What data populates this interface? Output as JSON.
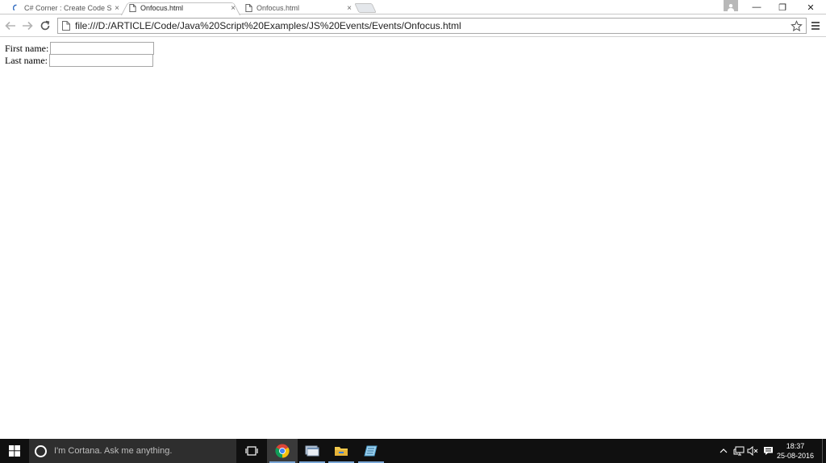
{
  "browser": {
    "tabs": [
      {
        "title": "C# Corner : Create Code S",
        "close": "×",
        "active": false
      },
      {
        "title": "Onfocus.html",
        "close": "×",
        "active": true
      },
      {
        "title": "Onfocus.html",
        "close": "×",
        "active": false
      }
    ],
    "window_controls": {
      "minimize": "—",
      "restore": "❐",
      "close": "✕"
    },
    "address": {
      "url": "file:///D:/ARTICLE/Code/Java%20Script%20Examples/JS%20Events/Events/Onfocus.html"
    },
    "icons": {
      "back": "back-arrow-icon",
      "forward": "forward-arrow-icon",
      "reload": "reload-icon",
      "page": "page-icon",
      "bookmark": "star-icon",
      "menu": "hamburger-menu-icon",
      "user": "user-icon"
    }
  },
  "page": {
    "first_name_label": "First name:",
    "first_name_value": "",
    "last_name_label": "Last name:",
    "last_name_value": ""
  },
  "taskbar": {
    "search_placeholder": "I'm Cortana. Ask me anything.",
    "apps": [
      "task-view-icon",
      "chrome-icon",
      "explorer-window-icon",
      "file-explorer-icon",
      "notepad-icon"
    ],
    "tray_icons": [
      "chevron-up-icon",
      "network-icon",
      "volume-muted-icon",
      "notification-icon"
    ],
    "time": "18:37",
    "date": "25-08-2016"
  },
  "colors": {
    "taskbar_bg": "#101010",
    "cortana_bg": "#2e2e2e",
    "running_indicator": "#7aa6d6"
  }
}
